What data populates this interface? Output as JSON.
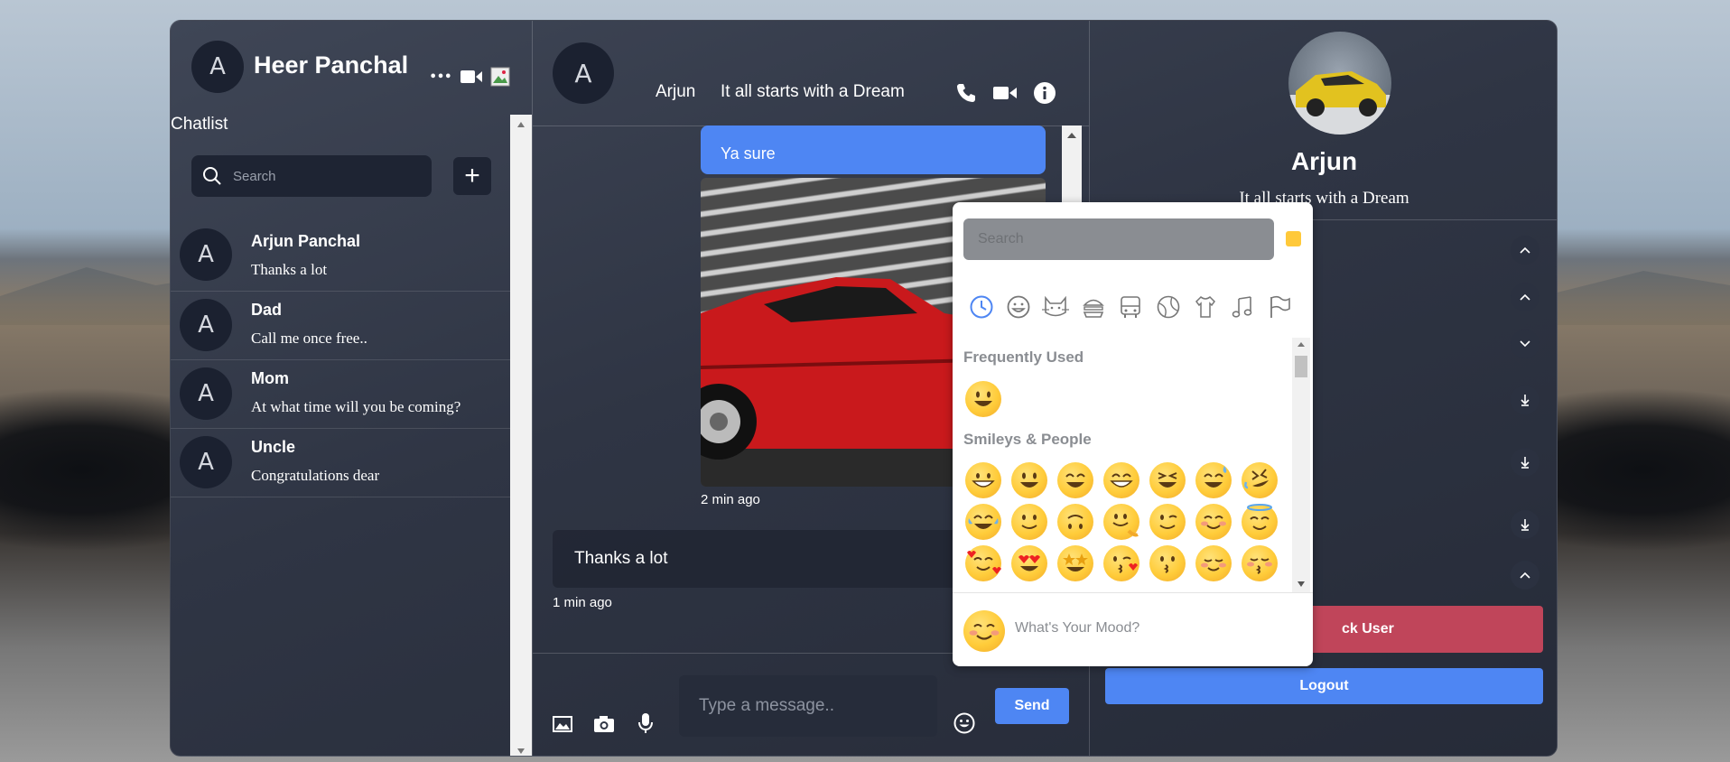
{
  "sidebar": {
    "avatar_letter": "A",
    "user_name": "Heer Panchal",
    "more_glyph": "•••",
    "title": "Chatlist",
    "search_placeholder": "Search",
    "add_glyph": "+",
    "chats": [
      {
        "avatar": "A",
        "name": "Arjun Panchal",
        "last": "Thanks a lot"
      },
      {
        "avatar": "A",
        "name": "Dad",
        "last": "Call me once free.."
      },
      {
        "avatar": "A",
        "name": "Mom",
        "last": "At what time will you be coming?"
      },
      {
        "avatar": "A",
        "name": "Uncle",
        "last": "Congratulations dear"
      }
    ]
  },
  "chat": {
    "header": {
      "avatar": "A",
      "name": "Arjun",
      "status": "It all starts with a Dream"
    },
    "messages": {
      "sent_text": "Ya sure",
      "image_time": "2 min ago",
      "received_text": "Thanks a lot",
      "received_time": "1 min ago"
    },
    "input_placeholder": "Type a message..",
    "send_label": "Send"
  },
  "profile": {
    "name": "Arjun",
    "status": "It all starts with a Dream",
    "block_label": "ck User",
    "logout_label": "Logout"
  },
  "emoji_picker": {
    "search_placeholder": "Search",
    "frequently_used_label": "Frequently Used",
    "smileys_label": "Smileys & People",
    "mood_placeholder": "What's Your Mood?"
  },
  "colors": {
    "accent_blue": "#4e86f3",
    "danger": "#c0455a",
    "panel_dark": "#2f3544"
  }
}
